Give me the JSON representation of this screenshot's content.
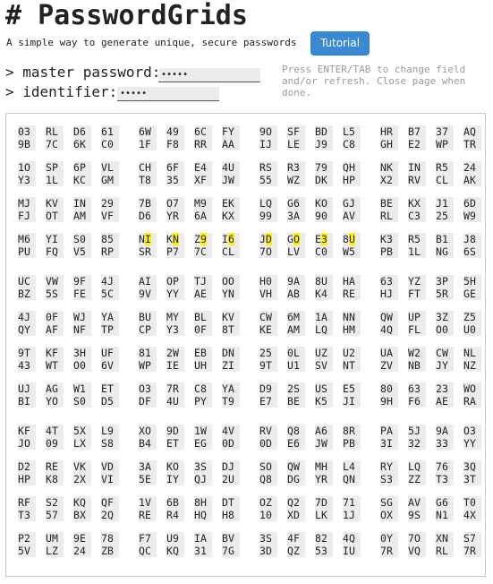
{
  "header": {
    "title": "# PasswordGrids",
    "subtitle": "A simple way to generate unique, secure passwords",
    "tutorial_label": "Tutorial"
  },
  "form": {
    "master_label": "> master password:",
    "master_value": "•••••",
    "identifier_label": "> identifier:",
    "identifier_value": "•••••",
    "hint": "Press ENTER/TAB to change field and/or refresh. Close page when done."
  },
  "grid": {
    "rows": [
      [
        "03",
        "RL",
        "D6",
        "61",
        "6W",
        "49",
        "6C",
        "FY",
        "9O",
        "SF",
        "BD",
        "L5",
        "HR",
        "B7",
        "37",
        "AQ"
      ],
      [
        "9B",
        "7C",
        "6K",
        "C0",
        "1F",
        "F8",
        "RR",
        "AA",
        "IJ",
        "LE",
        "J9",
        "C8",
        "GH",
        "E2",
        "WP",
        "TR"
      ],
      [
        "1O",
        "SP",
        "6P",
        "VL",
        "CH",
        "6F",
        "E4",
        "4U",
        "RS",
        "R3",
        "79",
        "QH",
        "NK",
        "IN",
        "R5",
        "24"
      ],
      [
        "Y3",
        "1L",
        "KC",
        "GM",
        "T8",
        "35",
        "XF",
        "JW",
        "55",
        "WZ",
        "DK",
        "HP",
        "X2",
        "RV",
        "CL",
        "AK"
      ],
      [
        "MJ",
        "KV",
        "IN",
        "29",
        "7B",
        "O7",
        "M9",
        "EK",
        "LQ",
        "G6",
        "KO",
        "GJ",
        "BE",
        "KX",
        "J1",
        "6D"
      ],
      [
        "FJ",
        "OT",
        "AM",
        "VF",
        "D6",
        "YR",
        "6A",
        "KX",
        "99",
        "3A",
        "90",
        "AV",
        "RL",
        "C3",
        "25",
        "W9"
      ],
      [
        "M6",
        "YI",
        "S0",
        "85",
        "NI",
        "KN",
        "Z9",
        "I6",
        "JD",
        "GO",
        "E3",
        "8U",
        "K3",
        "R5",
        "B1",
        "J8"
      ],
      [
        "PU",
        "FQ",
        "V5",
        "RP",
        "SR",
        "P7",
        "7C",
        "CL",
        "7O",
        "LV",
        "C0",
        "W5",
        "PB",
        "1L",
        "NG",
        "6S"
      ],
      [
        "UC",
        "VW",
        "9F",
        "4J",
        "AI",
        "OP",
        "TJ",
        "OO",
        "H0",
        "9A",
        "8U",
        "HA",
        "63",
        "YZ",
        "3P",
        "5H"
      ],
      [
        "BZ",
        "5S",
        "FE",
        "5C",
        "9V",
        "YY",
        "AE",
        "YN",
        "VH",
        "AB",
        "K4",
        "RE",
        "HJ",
        "FT",
        "5R",
        "GE"
      ],
      [
        "4J",
        "0F",
        "WJ",
        "YA",
        "BU",
        "MY",
        "BL",
        "KV",
        "CW",
        "6M",
        "1A",
        "NN",
        "QW",
        "UP",
        "3Z",
        "Z5"
      ],
      [
        "QY",
        "AF",
        "NF",
        "TP",
        "CP",
        "Y3",
        "0F",
        "8T",
        "KE",
        "AM",
        "LQ",
        "HM",
        "4Q",
        "FL",
        "O0",
        "U0"
      ],
      [
        "9T",
        "KF",
        "3H",
        "UF",
        "81",
        "2W",
        "EB",
        "DN",
        "25",
        "0L",
        "UZ",
        "U2",
        "UA",
        "W2",
        "CW",
        "NL"
      ],
      [
        "43",
        "WT",
        "O0",
        "6V",
        "WP",
        "IE",
        "UH",
        "ZI",
        "9T",
        "U1",
        "SV",
        "NT",
        "ZV",
        "NB",
        "JY",
        "NZ"
      ],
      [
        "UJ",
        "AG",
        "W1",
        "ET",
        "O3",
        "7R",
        "C8",
        "YA",
        "D9",
        "2S",
        "US",
        "E5",
        "80",
        "63",
        "23",
        "WO"
      ],
      [
        "BI",
        "YO",
        "S0",
        "D5",
        "DF",
        "4U",
        "PY",
        "T9",
        "E7",
        "BE",
        "K5",
        "JI",
        "9H",
        "F6",
        "AE",
        "RA"
      ],
      [
        "KF",
        "4T",
        "5X",
        "L9",
        "XO",
        "9D",
        "1W",
        "4V",
        "RV",
        "Q8",
        "A6",
        "8R",
        "PA",
        "5J",
        "9A",
        "O3"
      ],
      [
        "JO",
        "09",
        "LX",
        "S8",
        "B4",
        "ET",
        "EG",
        "0D",
        "0D",
        "E6",
        "JW",
        "PB",
        "3I",
        "32",
        "33",
        "YY"
      ],
      [
        "D2",
        "RE",
        "VK",
        "VD",
        "3A",
        "KO",
        "3S",
        "DJ",
        "SO",
        "QW",
        "MH",
        "L4",
        "RY",
        "LQ",
        "76",
        "3Q"
      ],
      [
        "HP",
        "K8",
        "2X",
        "VI",
        "5E",
        "IY",
        "QJ",
        "2U",
        "Q8",
        "DG",
        "YR",
        "QN",
        "S3",
        "ZZ",
        "T3",
        "3T"
      ],
      [
        "RF",
        "S2",
        "KQ",
        "QF",
        "1V",
        "6B",
        "8H",
        "DT",
        "OZ",
        "Q2",
        "7D",
        "71",
        "SG",
        "AV",
        "G6",
        "T0"
      ],
      [
        "T3",
        "57",
        "BX",
        "2Q",
        "RE",
        "R4",
        "HQ",
        "H8",
        "10",
        "XD",
        "LK",
        "1J",
        "OX",
        "9S",
        "N1",
        "4X"
      ],
      [
        "P2",
        "UM",
        "9E",
        "78",
        "F7",
        "U9",
        "IA",
        "BV",
        "3S",
        "4F",
        "82",
        "4Q",
        "0Y",
        "7O",
        "XN",
        "S7"
      ],
      [
        "5V",
        "LZ",
        "24",
        "ZB",
        "QC",
        "KQ",
        "31",
        "7G",
        "3D",
        "QZ",
        "53",
        "IU",
        "7R",
        "VQ",
        "RL",
        "7R"
      ]
    ],
    "highlight": {
      "row": 6,
      "chars": [
        [
          4,
          1
        ],
        [
          5,
          1
        ],
        [
          6,
          1
        ],
        [
          7,
          1
        ],
        [
          8,
          1
        ],
        [
          9,
          1
        ],
        [
          10,
          1
        ],
        [
          11,
          1
        ]
      ]
    },
    "highlight_color": "#fff200"
  }
}
